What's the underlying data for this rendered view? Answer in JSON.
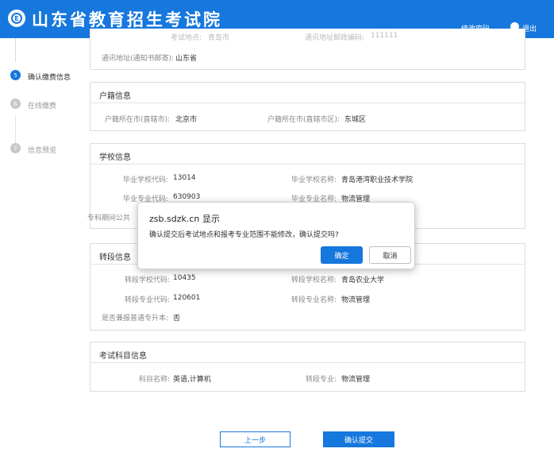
{
  "header": {
    "site_title": "山东省教育招生考试院",
    "change_password": "修改密码",
    "logout": "退出"
  },
  "steps": [
    {
      "num": "5",
      "label": "确认缴费信息",
      "active": true
    },
    {
      "num": "6",
      "label": "在线缴费",
      "active": false
    },
    {
      "num": "7",
      "label": "信息预览",
      "active": false
    }
  ],
  "address_card": {
    "cut_label1": "考试地点:",
    "cut_value1": "青岛市",
    "cut_label2": "通讯地址邮政编码:",
    "cut_value2": "111111",
    "address_label": "通讯地址(通知书邮寄):",
    "address_value": "山东省"
  },
  "household_card": {
    "title": "户籍信息",
    "province_label": "户籍所在市(直辖市):",
    "province_value": "北京市",
    "district_label": "户籍所在市(直辖市区):",
    "district_value": "东城区"
  },
  "school_card": {
    "title": "学校信息",
    "school_code_label": "毕业学校代码:",
    "school_code_value": "13014",
    "school_name_label": "毕业学校名称:",
    "school_name_value": "青岛港湾职业技术学院",
    "major_code_label": "毕业专业代码:",
    "major_code_value": "630903",
    "major_name_label": "毕业专业名称:",
    "major_name_value": "物流管理",
    "partial_label": "专科期间公共"
  },
  "transfer_card": {
    "title": "转段信息",
    "school_code_label": "转段学校代码:",
    "school_code_value": "10435",
    "school_name_label": "转段学校名称:",
    "school_name_value": "青岛农业大学",
    "major_code_label": "转段专业代码:",
    "major_code_value": "120601",
    "major_name_label": "转段专业名称:",
    "major_name_value": "物流管理",
    "general_label": "是否兼报普通专升本:",
    "general_value": "否"
  },
  "exam_card": {
    "title": "考试科目信息",
    "subject_label": "科目名称:",
    "subject_value": "英语,计算机",
    "major_label": "转段专业:",
    "major_value": "物流管理"
  },
  "dialog": {
    "title": "zsb.sdzk.cn 显示",
    "message": "确认提交后考试地点和报考专业范围不能修改，确认提交吗?",
    "ok": "确定",
    "cancel": "取消"
  },
  "footer": {
    "prev": "上一步",
    "submit": "确认提交"
  },
  "colors": {
    "brand": "#1677dd",
    "step_inactive": "#c8c8c8"
  }
}
